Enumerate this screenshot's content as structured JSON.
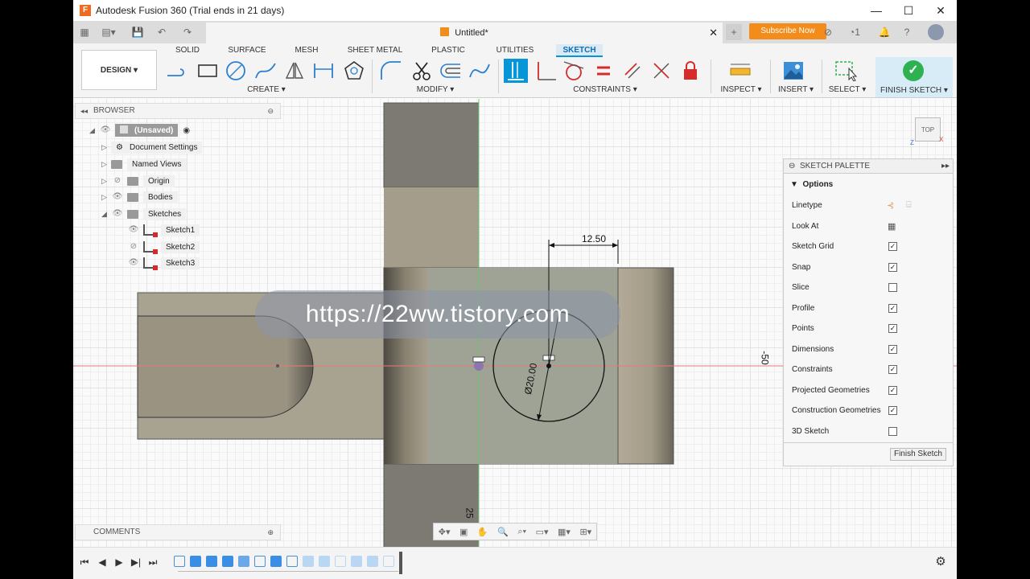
{
  "window": {
    "title": "Autodesk Fusion 360 (Trial ends in 21 days)",
    "logo_letter": "F"
  },
  "tabbar": {
    "doc_title": "Untitled*",
    "subscribe_label": "Subscribe Now",
    "notifications_count": "1"
  },
  "toolbar": {
    "design_label": "DESIGN ▾",
    "workspace_tabs": [
      "SOLID",
      "SURFACE",
      "MESH",
      "SHEET METAL",
      "PLASTIC",
      "UTILITIES",
      "SKETCH"
    ],
    "active_tab": "SKETCH",
    "groups": {
      "create": "CREATE ▾",
      "modify": "MODIFY ▾",
      "constraints": "CONSTRAINTS ▾",
      "inspect": "INSPECT ▾",
      "insert": "INSERT ▾",
      "select": "SELECT ▾",
      "finish": "FINISH SKETCH ▾"
    }
  },
  "browser": {
    "title": "BROWSER",
    "root": "(Unsaved)",
    "items": [
      "Document Settings",
      "Named Views",
      "Origin",
      "Bodies",
      "Sketches"
    ],
    "sketches": [
      "Sketch1",
      "Sketch2",
      "Sketch3"
    ]
  },
  "comments": {
    "title": "COMMENTS"
  },
  "viewcube": {
    "label": "TOP"
  },
  "sketch": {
    "dimension_width": "12.50",
    "dimension_diameter": "Ø20.00",
    "axis_label_right": "-50",
    "axis_label_bottom": "25"
  },
  "palette": {
    "title": "SKETCH PALETTE",
    "section": "Options",
    "options": [
      {
        "name": "Linetype",
        "type": "icons"
      },
      {
        "name": "Look At",
        "type": "icon"
      },
      {
        "name": "Sketch Grid",
        "checked": true
      },
      {
        "name": "Snap",
        "checked": true
      },
      {
        "name": "Slice",
        "checked": false
      },
      {
        "name": "Profile",
        "checked": true
      },
      {
        "name": "Points",
        "checked": true
      },
      {
        "name": "Dimensions",
        "checked": true
      },
      {
        "name": "Constraints",
        "checked": true
      },
      {
        "name": "Projected Geometries",
        "checked": true
      },
      {
        "name": "Construction Geometries",
        "checked": true
      },
      {
        "name": "3D Sketch",
        "checked": false
      }
    ],
    "finish_label": "Finish Sketch"
  },
  "watermark": "https://22ww.tistory.com",
  "colors": {
    "accent": "#0696d7",
    "subscribe": "#f28c1a",
    "finish_check": "#2eb24f"
  }
}
